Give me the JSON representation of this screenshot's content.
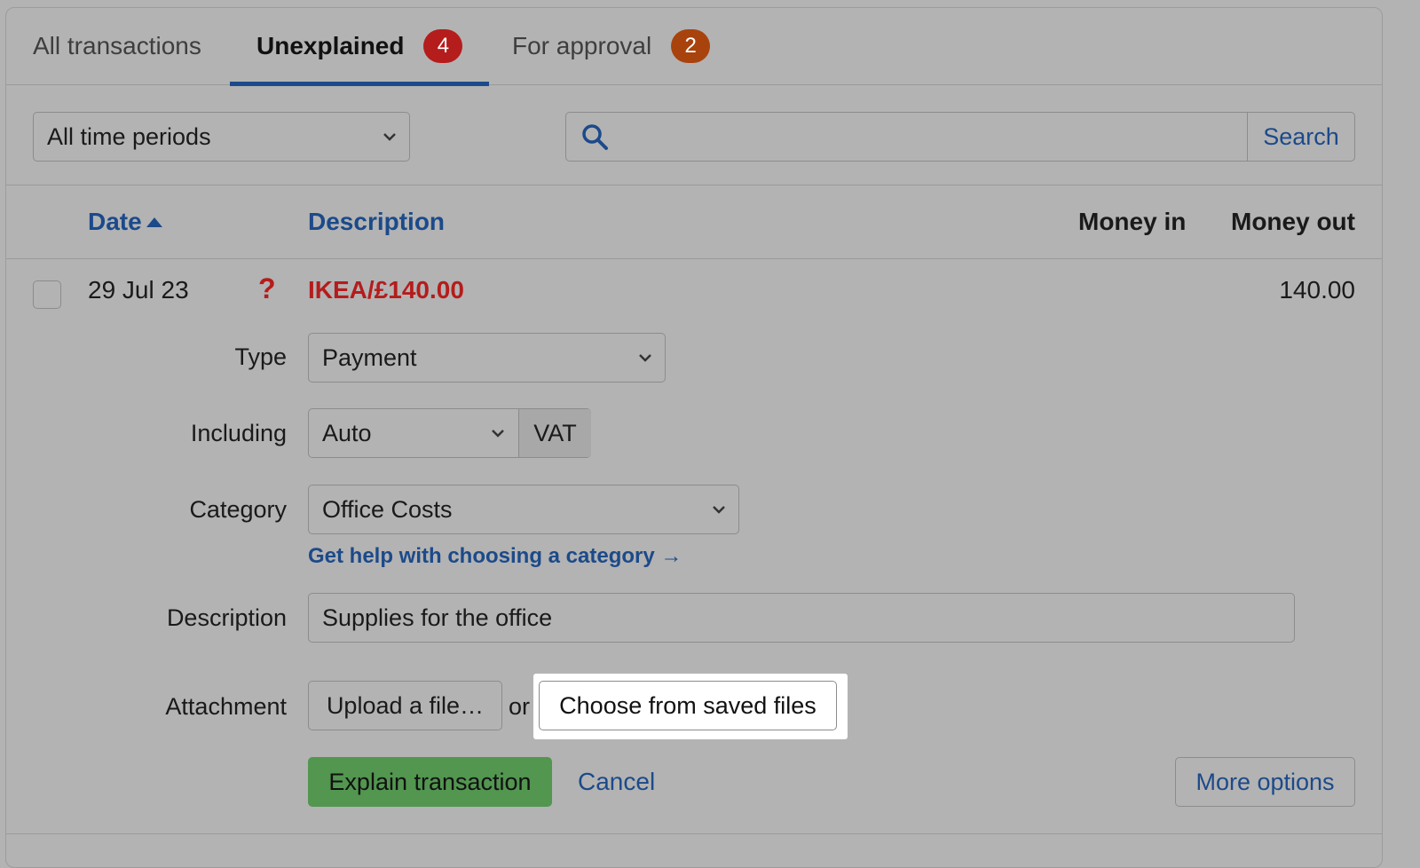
{
  "tabs": [
    {
      "label": "All transactions",
      "badge": ""
    },
    {
      "label": "Unexplained",
      "badge": "4",
      "badge_color": "#b51c1c"
    },
    {
      "label": "For approval",
      "badge": "2",
      "badge_color": "#a8430d"
    }
  ],
  "filters": {
    "period": "All time periods",
    "search_value": "",
    "search_button": "Search"
  },
  "table": {
    "columns": {
      "date": "Date",
      "description": "Description",
      "money_in": "Money in",
      "money_out": "Money out"
    },
    "row": {
      "date": "29 Jul 23",
      "status_glyph": "?",
      "description": "IKEA/£140.00",
      "money_out": "140.00"
    }
  },
  "form": {
    "type_label": "Type",
    "type_value": "Payment",
    "including_label": "Including",
    "including_value": "Auto",
    "vat_label": "VAT",
    "category_label": "Category",
    "category_value": "Office Costs",
    "category_help": "Get help with choosing a category →",
    "description_label": "Description",
    "description_value": "Supplies for the office",
    "attachment_label": "Attachment",
    "upload_button": "Upload a file…",
    "or_text": "or",
    "saved_files_button": "Choose from saved files"
  },
  "actions": {
    "explain": "Explain transaction",
    "cancel": "Cancel",
    "more": "More options"
  },
  "colors": {
    "accent_blue": "#1c4a8a",
    "unexplained_red": "#b51c1c",
    "explain_green": "#529650"
  }
}
